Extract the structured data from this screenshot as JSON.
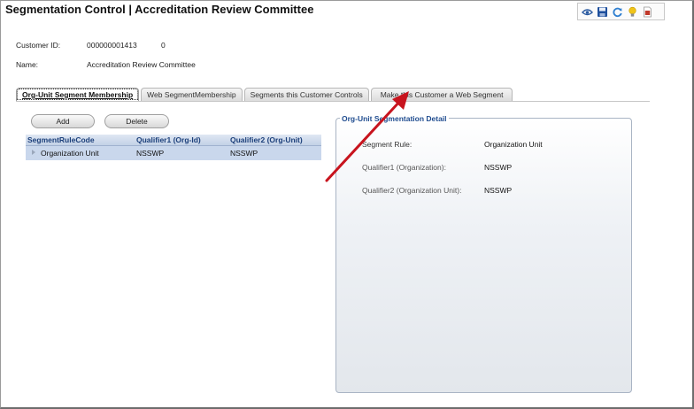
{
  "window": {
    "title": "Segmentation Control | Accreditation Review Committee"
  },
  "toolbar": [
    {
      "icon": "view-icon",
      "color": "#2a5aa0"
    },
    {
      "icon": "save-icon",
      "color": "#1e4f9c"
    },
    {
      "icon": "refresh-icon",
      "color": "#2f7fd0"
    },
    {
      "icon": "lightbulb-icon",
      "color": "#f0c419"
    },
    {
      "icon": "pdf-icon",
      "color": "#c0392b"
    }
  ],
  "customer": {
    "id_label": "Customer ID:",
    "id_value": "000000001413",
    "id_suffix": "0",
    "name_label": "Name:",
    "name_value": "Accreditation Review Committee"
  },
  "tabs": [
    {
      "label": "Org-Unit Segment Membership",
      "active": true
    },
    {
      "label": "Web SegmentMembership",
      "active": false
    },
    {
      "label": "Segments this Customer Controls",
      "active": false
    },
    {
      "label": "Make this Customer a Web Segment",
      "active": false
    }
  ],
  "actions": {
    "add_label": "Add",
    "delete_label": "Delete"
  },
  "grid": {
    "columns": [
      "SegmentRuleCode",
      "Qualifier1 (Org-Id)",
      "Qualifier2 (Org-Unit)"
    ],
    "rows": [
      {
        "rule": "Organization Unit",
        "q1": "NSSWP",
        "q2": "NSSWP"
      }
    ]
  },
  "detail": {
    "title": "Org-Unit Segmentation Detail",
    "segment_rule_label": "Segment Rule:",
    "segment_rule_value": "Organization Unit",
    "qualifier1_label": "Qualifier1 (Organization):",
    "qualifier1_value": "NSSWP",
    "qualifier2_label": "Qualifier2 (Organization Unit):",
    "qualifier2_value": "NSSWP"
  },
  "annotation": {
    "arrow_color": "#c8141e"
  }
}
